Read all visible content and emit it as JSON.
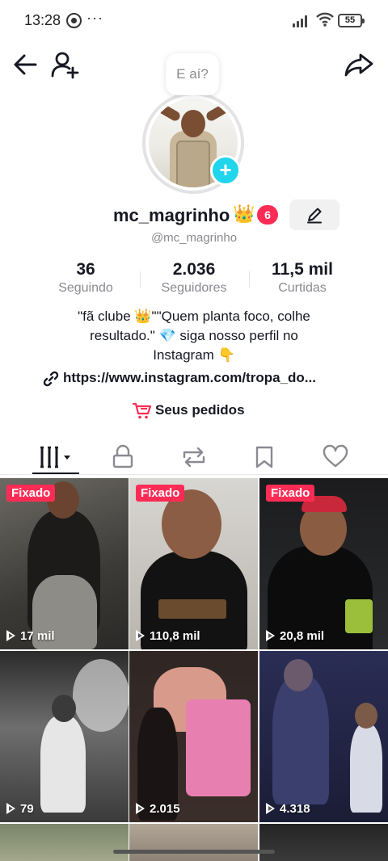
{
  "status_bar": {
    "time": "13:28",
    "dots": "···",
    "battery": "55",
    "icons": [
      "whatsapp-icon",
      "signal-icon",
      "wifi-icon",
      "battery-icon"
    ]
  },
  "top_nav": {
    "icons": [
      "back-arrow-icon",
      "add-user-icon",
      "share-icon"
    ]
  },
  "profile": {
    "bubble_text": "E aí?",
    "avatar_add_label": "+",
    "username": "mc_magrinho",
    "crown": "👑",
    "notification_count": "6",
    "handle": "@mc_magrinho"
  },
  "stats": [
    {
      "value": "36",
      "label": "Seguindo"
    },
    {
      "value": "2.036",
      "label": "Seguidores"
    },
    {
      "value": "11,5 mil",
      "label": "Curtidas"
    }
  ],
  "bio": {
    "line1": "\"fã clube 👑\"\"Quem planta foco, colhe",
    "line2": "resultado.\" 💎 siga nosso perfil no",
    "line3": "Instagram 👇",
    "link": "https://www.instagram.com/tropa_do...",
    "orders_label": "Seus pedidos"
  },
  "tabs": [
    "videos-tab",
    "private-tab",
    "reposts-tab",
    "favorites-tab",
    "liked-tab"
  ],
  "videos": [
    {
      "pinned_label": "Fixado",
      "views": "17 mil"
    },
    {
      "pinned_label": "Fixado",
      "views": "110,8 mil"
    },
    {
      "pinned_label": "Fixado",
      "views": "20,8 mil"
    },
    {
      "pinned_label": "",
      "views": "79"
    },
    {
      "pinned_label": "",
      "views": "2.015"
    },
    {
      "pinned_label": "",
      "views": "4.318"
    }
  ],
  "colors": {
    "accent": "#fe2c55",
    "avatar_add": "#20d5ec",
    "text_primary": "#161823",
    "text_secondary": "#8a8b91"
  }
}
